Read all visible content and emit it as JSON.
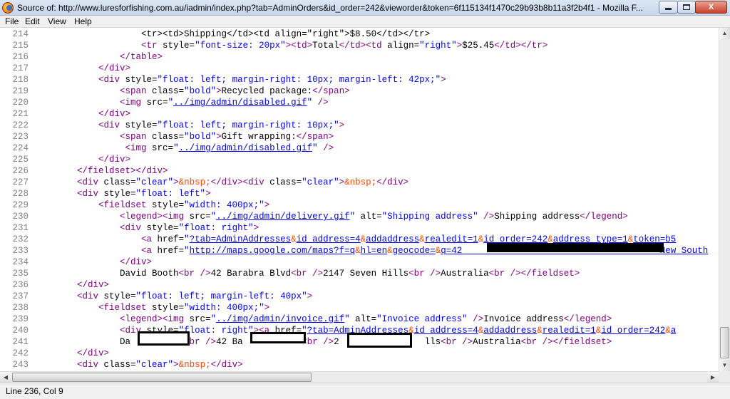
{
  "window": {
    "title": "Source of: http://www.luresforfishing.com.au/iadmin/index.php?tab=AdminOrders&id_order=242&vieworder&token=6f115134f1470c29b93b8b11a3f2b4f1 - Mozilla F...",
    "app_icon": "firefox-icon",
    "controls": {
      "minimize": "minimize-icon",
      "maximize": "maximize-icon",
      "close_label": "X"
    }
  },
  "menu": {
    "file": "File",
    "edit": "Edit",
    "view": "View",
    "help": "Help"
  },
  "source": {
    "lines": [
      {
        "num": "214",
        "indent": "            ",
        "tokens": [
          {
            "t": "p",
            "v": "<tr><td>Shipping</td><td align=\"right\">$8.50</td></tr>"
          }
        ]
      },
      {
        "num": "215",
        "indent": "            ",
        "tokens": [
          {
            "t": "tag",
            "v": "<tr"
          },
          {
            "t": "an",
            "v": " style="
          },
          {
            "t": "av",
            "v": "\"font-size: 20px\""
          },
          {
            "t": "tag",
            "v": "><td>"
          },
          {
            "t": "p",
            "v": "Total"
          },
          {
            "t": "tag",
            "v": "</td><td"
          },
          {
            "t": "an",
            "v": " align="
          },
          {
            "t": "av",
            "v": "\"right\""
          },
          {
            "t": "tag",
            "v": ">"
          },
          {
            "t": "p",
            "v": "$25.45"
          },
          {
            "t": "tag",
            "v": "</td></tr>"
          }
        ]
      },
      {
        "num": "216",
        "indent": "        ",
        "tokens": [
          {
            "t": "tag",
            "v": "</table>"
          }
        ]
      },
      {
        "num": "217",
        "indent": "    ",
        "tokens": [
          {
            "t": "tag",
            "v": "</div>"
          }
        ]
      },
      {
        "num": "218",
        "indent": "    ",
        "tokens": [
          {
            "t": "tag",
            "v": "<div"
          },
          {
            "t": "an",
            "v": " style="
          },
          {
            "t": "av",
            "v": "\"float: left; margin-right: 10px; margin-left: 42px;\""
          },
          {
            "t": "tag",
            "v": ">"
          }
        ]
      },
      {
        "num": "219",
        "indent": "        ",
        "tokens": [
          {
            "t": "tag",
            "v": "<span"
          },
          {
            "t": "an",
            "v": " class="
          },
          {
            "t": "av",
            "v": "\"bold\""
          },
          {
            "t": "tag",
            "v": ">"
          },
          {
            "t": "p",
            "v": "Recycled package:"
          },
          {
            "t": "tag",
            "v": "</span>"
          }
        ]
      },
      {
        "num": "220",
        "indent": "        ",
        "tokens": [
          {
            "t": "tag",
            "v": "<img"
          },
          {
            "t": "an",
            "v": " src="
          },
          {
            "t": "av",
            "v": "\""
          },
          {
            "t": "lk",
            "v": "../img/admin/disabled.gif"
          },
          {
            "t": "av",
            "v": "\""
          },
          {
            "t": "tag",
            "v": " />"
          }
        ]
      },
      {
        "num": "221",
        "indent": "    ",
        "tokens": [
          {
            "t": "tag",
            "v": "</div>"
          }
        ]
      },
      {
        "num": "222",
        "indent": "    ",
        "tokens": [
          {
            "t": "tag",
            "v": "<div"
          },
          {
            "t": "an",
            "v": " style="
          },
          {
            "t": "av",
            "v": "\"float: left; margin-right: 10px;\""
          },
          {
            "t": "tag",
            "v": ">"
          }
        ]
      },
      {
        "num": "223",
        "indent": "        ",
        "tokens": [
          {
            "t": "tag",
            "v": "<span"
          },
          {
            "t": "an",
            "v": " class="
          },
          {
            "t": "av",
            "v": "\"bold\""
          },
          {
            "t": "tag",
            "v": ">"
          },
          {
            "t": "p",
            "v": "Gift wrapping:"
          },
          {
            "t": "tag",
            "v": "</span>"
          }
        ]
      },
      {
        "num": "224",
        "indent": "         ",
        "tokens": [
          {
            "t": "tag",
            "v": "<img"
          },
          {
            "t": "an",
            "v": " src="
          },
          {
            "t": "av",
            "v": "\""
          },
          {
            "t": "lk",
            "v": "../img/admin/disabled.gif"
          },
          {
            "t": "av",
            "v": "\""
          },
          {
            "t": "tag",
            "v": " />"
          }
        ]
      },
      {
        "num": "225",
        "indent": "    ",
        "tokens": [
          {
            "t": "tag",
            "v": "</div>"
          }
        ]
      },
      {
        "num": "226",
        "indent": "",
        "tokens": [
          {
            "t": "tag",
            "v": "</fieldset></div>"
          }
        ]
      },
      {
        "num": "227",
        "indent": "",
        "tokens": [
          {
            "t": "tag",
            "v": "<div"
          },
          {
            "t": "an",
            "v": " class="
          },
          {
            "t": "av",
            "v": "\"clear\""
          },
          {
            "t": "tag",
            "v": ">"
          },
          {
            "t": "ent",
            "v": "&nbsp;"
          },
          {
            "t": "tag",
            "v": "</div><div"
          },
          {
            "t": "an",
            "v": " class="
          },
          {
            "t": "av",
            "v": "\"clear\""
          },
          {
            "t": "tag",
            "v": ">"
          },
          {
            "t": "ent",
            "v": "&nbsp;"
          },
          {
            "t": "tag",
            "v": "</div>"
          }
        ]
      },
      {
        "num": "228",
        "indent": "",
        "tokens": [
          {
            "t": "tag",
            "v": "<div"
          },
          {
            "t": "an",
            "v": " style="
          },
          {
            "t": "av",
            "v": "\"float: left\""
          },
          {
            "t": "tag",
            "v": ">"
          }
        ]
      },
      {
        "num": "229",
        "indent": "    ",
        "tokens": [
          {
            "t": "tag",
            "v": "<fieldset"
          },
          {
            "t": "an",
            "v": " style="
          },
          {
            "t": "av",
            "v": "\"width: 400px;\""
          },
          {
            "t": "tag",
            "v": ">"
          }
        ]
      },
      {
        "num": "230",
        "indent": "        ",
        "tokens": [
          {
            "t": "tag",
            "v": "<legend><img"
          },
          {
            "t": "an",
            "v": " src="
          },
          {
            "t": "av",
            "v": "\""
          },
          {
            "t": "lk",
            "v": "../img/admin/delivery.gif"
          },
          {
            "t": "av",
            "v": "\""
          },
          {
            "t": "an",
            "v": " alt="
          },
          {
            "t": "av",
            "v": "\"Shipping address\""
          },
          {
            "t": "tag",
            "v": " />"
          },
          {
            "t": "p",
            "v": "Shipping address"
          },
          {
            "t": "tag",
            "v": "</legend>"
          }
        ]
      },
      {
        "num": "231",
        "indent": "        ",
        "tokens": [
          {
            "t": "tag",
            "v": "<div"
          },
          {
            "t": "an",
            "v": " style="
          },
          {
            "t": "av",
            "v": "\"float: right\""
          },
          {
            "t": "tag",
            "v": ">"
          }
        ]
      },
      {
        "num": "232",
        "indent": "            ",
        "tokens": [
          {
            "t": "tag",
            "v": "<a"
          },
          {
            "t": "an",
            "v": " href="
          },
          {
            "t": "av",
            "v": "\""
          },
          {
            "t": "lk",
            "v": "?tab=AdminAddresses"
          },
          {
            "t": "ent",
            "v": "&"
          },
          {
            "t": "lk",
            "v": "id_address=4"
          },
          {
            "t": "ent",
            "v": "&"
          },
          {
            "t": "lk",
            "v": "addaddress"
          },
          {
            "t": "ent",
            "v": "&"
          },
          {
            "t": "lk",
            "v": "realedit=1"
          },
          {
            "t": "ent",
            "v": "&"
          },
          {
            "t": "lk",
            "v": "id_order=242"
          },
          {
            "t": "ent",
            "v": "&"
          },
          {
            "t": "lk",
            "v": "address_type=1"
          },
          {
            "t": "ent",
            "v": "&"
          },
          {
            "t": "lk",
            "v": "token=b5"
          }
        ]
      },
      {
        "num": "233",
        "indent": "            ",
        "tokens": [
          {
            "t": "tag",
            "v": "<a"
          },
          {
            "t": "an",
            "v": " href="
          },
          {
            "t": "av",
            "v": "\""
          },
          {
            "t": "lk",
            "v": "http://maps.google.com/maps?f=q"
          },
          {
            "t": "ent",
            "v": "&"
          },
          {
            "t": "lk",
            "v": "hl=en"
          },
          {
            "t": "ent",
            "v": "&"
          },
          {
            "t": "lk",
            "v": "geocode="
          },
          {
            "t": "ent",
            "v": "&"
          },
          {
            "t": "lk",
            "v": "q=42                                     New South"
          }
        ]
      },
      {
        "num": "234",
        "indent": "        ",
        "tokens": [
          {
            "t": "tag",
            "v": "</div>"
          }
        ]
      },
      {
        "num": "235",
        "indent": "        ",
        "tokens": [
          {
            "t": "p",
            "v": "David Booth"
          },
          {
            "t": "tag",
            "v": "<br />"
          },
          {
            "t": "p",
            "v": "42 Barabra Blvd"
          },
          {
            "t": "tag",
            "v": "<br />"
          },
          {
            "t": "p",
            "v": "2147 Seven Hills"
          },
          {
            "t": "tag",
            "v": "<br />"
          },
          {
            "t": "p",
            "v": "Australia"
          },
          {
            "t": "tag",
            "v": "<br /></fieldset>"
          }
        ]
      },
      {
        "num": "236",
        "indent": "",
        "tokens": [
          {
            "t": "tag",
            "v": "</div>"
          }
        ]
      },
      {
        "num": "237",
        "indent": "",
        "tokens": [
          {
            "t": "tag",
            "v": "<div"
          },
          {
            "t": "an",
            "v": " style="
          },
          {
            "t": "av",
            "v": "\"float: left; margin-left: 40px\""
          },
          {
            "t": "tag",
            "v": ">"
          }
        ]
      },
      {
        "num": "238",
        "indent": "    ",
        "tokens": [
          {
            "t": "tag",
            "v": "<fieldset"
          },
          {
            "t": "an",
            "v": " style="
          },
          {
            "t": "av",
            "v": "\"width: 400px;\""
          },
          {
            "t": "tag",
            "v": ">"
          }
        ]
      },
      {
        "num": "239",
        "indent": "        ",
        "tokens": [
          {
            "t": "tag",
            "v": "<legend><img"
          },
          {
            "t": "an",
            "v": " src="
          },
          {
            "t": "av",
            "v": "\""
          },
          {
            "t": "lk",
            "v": "../img/admin/invoice.gif"
          },
          {
            "t": "av",
            "v": "\""
          },
          {
            "t": "an",
            "v": " alt="
          },
          {
            "t": "av",
            "v": "\"Invoice address\""
          },
          {
            "t": "tag",
            "v": " />"
          },
          {
            "t": "p",
            "v": "Invoice address"
          },
          {
            "t": "tag",
            "v": "</legend>"
          }
        ]
      },
      {
        "num": "240",
        "indent": "        ",
        "tokens": [
          {
            "t": "tag",
            "v": "<div"
          },
          {
            "t": "an",
            "v": " style="
          },
          {
            "t": "av",
            "v": "\"float: right\""
          },
          {
            "t": "tag",
            "v": "><a"
          },
          {
            "t": "an",
            "v": " href="
          },
          {
            "t": "av",
            "v": "\""
          },
          {
            "t": "lk",
            "v": "?tab=AdminAddresses"
          },
          {
            "t": "ent",
            "v": "&"
          },
          {
            "t": "lk",
            "v": "id_address=4"
          },
          {
            "t": "ent",
            "v": "&"
          },
          {
            "t": "lk",
            "v": "addaddress"
          },
          {
            "t": "ent",
            "v": "&"
          },
          {
            "t": "lk",
            "v": "realedit=1"
          },
          {
            "t": "ent",
            "v": "&"
          },
          {
            "t": "lk",
            "v": "id_order=242"
          },
          {
            "t": "ent",
            "v": "&"
          },
          {
            "t": "lk",
            "v": "a"
          }
        ]
      },
      {
        "num": "241",
        "indent": "        ",
        "tokens": [
          {
            "t": "p",
            "v": "Da          "
          },
          {
            "t": "tag",
            "v": "<br />"
          },
          {
            "t": "p",
            "v": "42 Ba           "
          },
          {
            "t": "tag",
            "v": "<br />"
          },
          {
            "t": "p",
            "v": "2                lls"
          },
          {
            "t": "tag",
            "v": "<br />"
          },
          {
            "t": "p",
            "v": "Australia"
          },
          {
            "t": "tag",
            "v": "<br /></fieldset>"
          }
        ]
      },
      {
        "num": "242",
        "indent": "",
        "tokens": [
          {
            "t": "tag",
            "v": "</div>"
          }
        ]
      },
      {
        "num": "243",
        "indent": "",
        "tokens": [
          {
            "t": "tag",
            "v": "<div"
          },
          {
            "t": "an",
            "v": " class="
          },
          {
            "t": "av",
            "v": "\"clear\""
          },
          {
            "t": "tag",
            "v": ">"
          },
          {
            "t": "ent",
            "v": "&nbsp;"
          },
          {
            "t": "tag",
            "v": "</div>"
          }
        ]
      }
    ]
  },
  "scrollbars": {
    "vertical_position": 0.95,
    "horizontal_position": 0.0
  },
  "status": {
    "text": "Line 236, Col 9"
  },
  "colors": {
    "tag": "#800080",
    "attribute_value": "#0000ff",
    "link": "#0000ee",
    "entity": "#ff4500",
    "line_number": "#808080"
  }
}
